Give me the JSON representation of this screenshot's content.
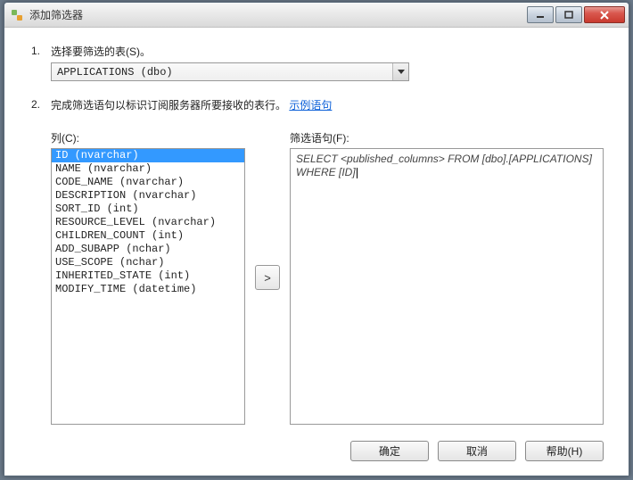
{
  "window": {
    "title": "添加筛选器"
  },
  "step1": {
    "num": "1.",
    "label": "选择要筛选的表(S)。",
    "table": "APPLICATIONS (dbo)"
  },
  "step2": {
    "num": "2.",
    "label_prefix": "完成筛选语句以标识订阅服务器所要接收的表行。",
    "link": "示例语句"
  },
  "columns": {
    "label": "列(C):",
    "items": [
      "ID (nvarchar)",
      "NAME (nvarchar)",
      "CODE_NAME (nvarchar)",
      "DESCRIPTION (nvarchar)",
      "SORT_ID (int)",
      "RESOURCE_LEVEL (nvarchar)",
      "CHILDREN_COUNT (int)",
      "ADD_SUBAPP (nchar)",
      "USE_SCOPE (nchar)",
      "INHERITED_STATE (int)",
      "MODIFY_TIME (datetime)"
    ],
    "selected_index": 0
  },
  "filter": {
    "label": "筛选语句(F):",
    "text": "SELECT <published_columns> FROM [dbo].[APPLICATIONS] WHERE [ID]"
  },
  "move_btn": ">",
  "buttons": {
    "ok": "确定",
    "cancel": "取消",
    "help": "帮助(H)"
  }
}
